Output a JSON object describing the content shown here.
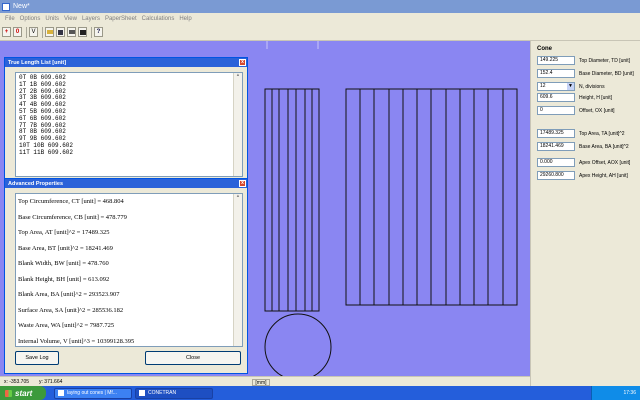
{
  "window": {
    "title": "New*"
  },
  "menu": [
    "File",
    "Options",
    "Units",
    "View",
    "Layers",
    "PaperSheet",
    "Calculations",
    "Help"
  ],
  "toolbar": {
    "buttons": [
      "+",
      "0",
      "V"
    ]
  },
  "panel": {
    "title": "Cone",
    "rows": [
      {
        "value": "149.225",
        "label": "Top Diameter, TD [unit]"
      },
      {
        "value": "152.4",
        "label": "Base Diameter, BD [unit]"
      },
      {
        "value": "12",
        "label": "N, divisions",
        "type": "select"
      },
      {
        "value": "609.6",
        "label": "Height, H [unit]"
      },
      {
        "value": "0",
        "label": "Offset, OX [unit]"
      },
      {
        "value": "17489.325",
        "label": "Top Area, TA [unit]^2"
      },
      {
        "value": "18241.469",
        "label": "Base Area, BA [unit]^2"
      },
      {
        "value": "0.000",
        "label": "Apex Offset, AOX [unit]"
      },
      {
        "value": "29260.800",
        "label": "Apex Height, AH [unit]"
      }
    ]
  },
  "true_length": {
    "title": "True Length List [unit]",
    "lines": [
      "0T 0B 609.602",
      "1T 1B 609.602",
      "2T 2B 609.602",
      "3T 3B 609.602",
      "4T 4B 609.602",
      "5T 5B 609.602",
      "6T 6B 609.602",
      "7T 7B 609.602",
      "8T 8B 609.602",
      "9T 9B 609.602",
      "10T 10B 609.602",
      "11T 11B 609.602"
    ]
  },
  "advanced": {
    "title": "Advanced Properties",
    "lines": [
      "Top Circumference, CT [unit] = 468.804",
      "Base Circumference, CB [unit] = 478.779",
      "Top Area, AT [unit]^2 = 17489.325",
      "Base Area, BT [unit]^2 = 18241.469",
      "Blank Width, BW [unit] = 478.760",
      "Blank Height, BH [unit] = 613.092",
      "Blank Area, BA [unit]^2 = 293523.907",
      "Surface Area, SA [unit]^2 = 285536.182",
      "Waste Area, WA [unit]^2 = 7987.725",
      "Internal Volume, V [unit]^3 = 10399128.395"
    ],
    "save_label": "Save Log",
    "close_label": "Close"
  },
  "status": {
    "x": "x: -353.705",
    "y": "y: 371.664",
    "unit": "[mm]"
  },
  "taskbar": {
    "start_label": "start",
    "items": [
      "laying out cones | Mf...",
      "CONETRAN"
    ],
    "clock": "17:36"
  },
  "colors": {
    "canvas": "#8a86f2",
    "titlebar": "#7a9ad3",
    "taskbar": "#245edb"
  }
}
